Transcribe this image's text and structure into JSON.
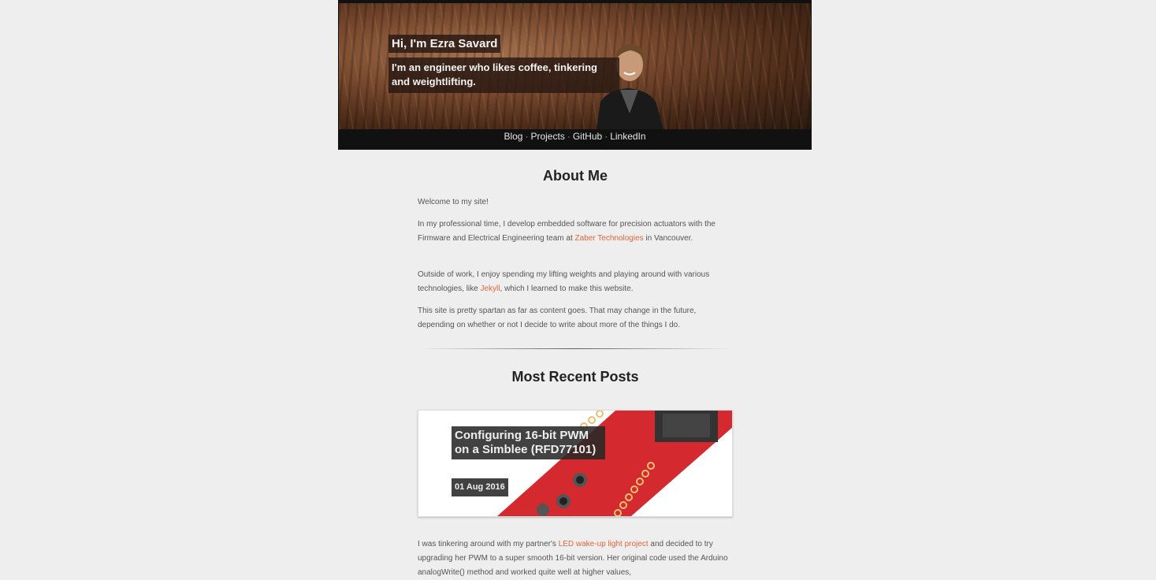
{
  "hero": {
    "title": "Hi, I'm Ezra Savard",
    "subtitle": "I'm an engineer who likes coffee, tinkering and weightlifting."
  },
  "nav": {
    "items": [
      {
        "label": "Blog"
      },
      {
        "label": "Projects"
      },
      {
        "label": "GitHub"
      },
      {
        "label": "LinkedIn"
      }
    ],
    "separator": "·"
  },
  "about": {
    "title": "About Me",
    "p1": "Welcome to my site!",
    "p2_before": "In my professional time, I develop embedded software for precision actuators with the Firmware and Electrical Engineering team at ",
    "p2_link": "Zaber Technologies",
    "p2_after": " in Vancouver.",
    "p3_before": "Outside of work, I enjoy spending my lifting weights and playing around with various technologies, like ",
    "p3_link": "Jekyll",
    "p3_after": ", which I learned to make this website.",
    "p4": "This site is pretty spartan as far as content goes. That may change in the future, depending on whether or not I decide to write about more of the things I do."
  },
  "posts": {
    "title": "Most Recent Posts",
    "items": [
      {
        "title": "Configuring 16-bit PWM on a Simblee (RFD77101)",
        "date": "01 Aug 2016",
        "excerpt_before": "I was tinkering around with my partner's ",
        "excerpt_link": "LED wake-up light project",
        "excerpt_after": " and decided to try upgrading her PWM to a super smooth 16-bit version. Her original code used the Arduino analogWrite() method and worked quite well at higher values,"
      }
    ]
  },
  "colors": {
    "background": "#eeeeee",
    "header": "#111111",
    "link": "#e0663a",
    "board": "#d42a2f"
  }
}
